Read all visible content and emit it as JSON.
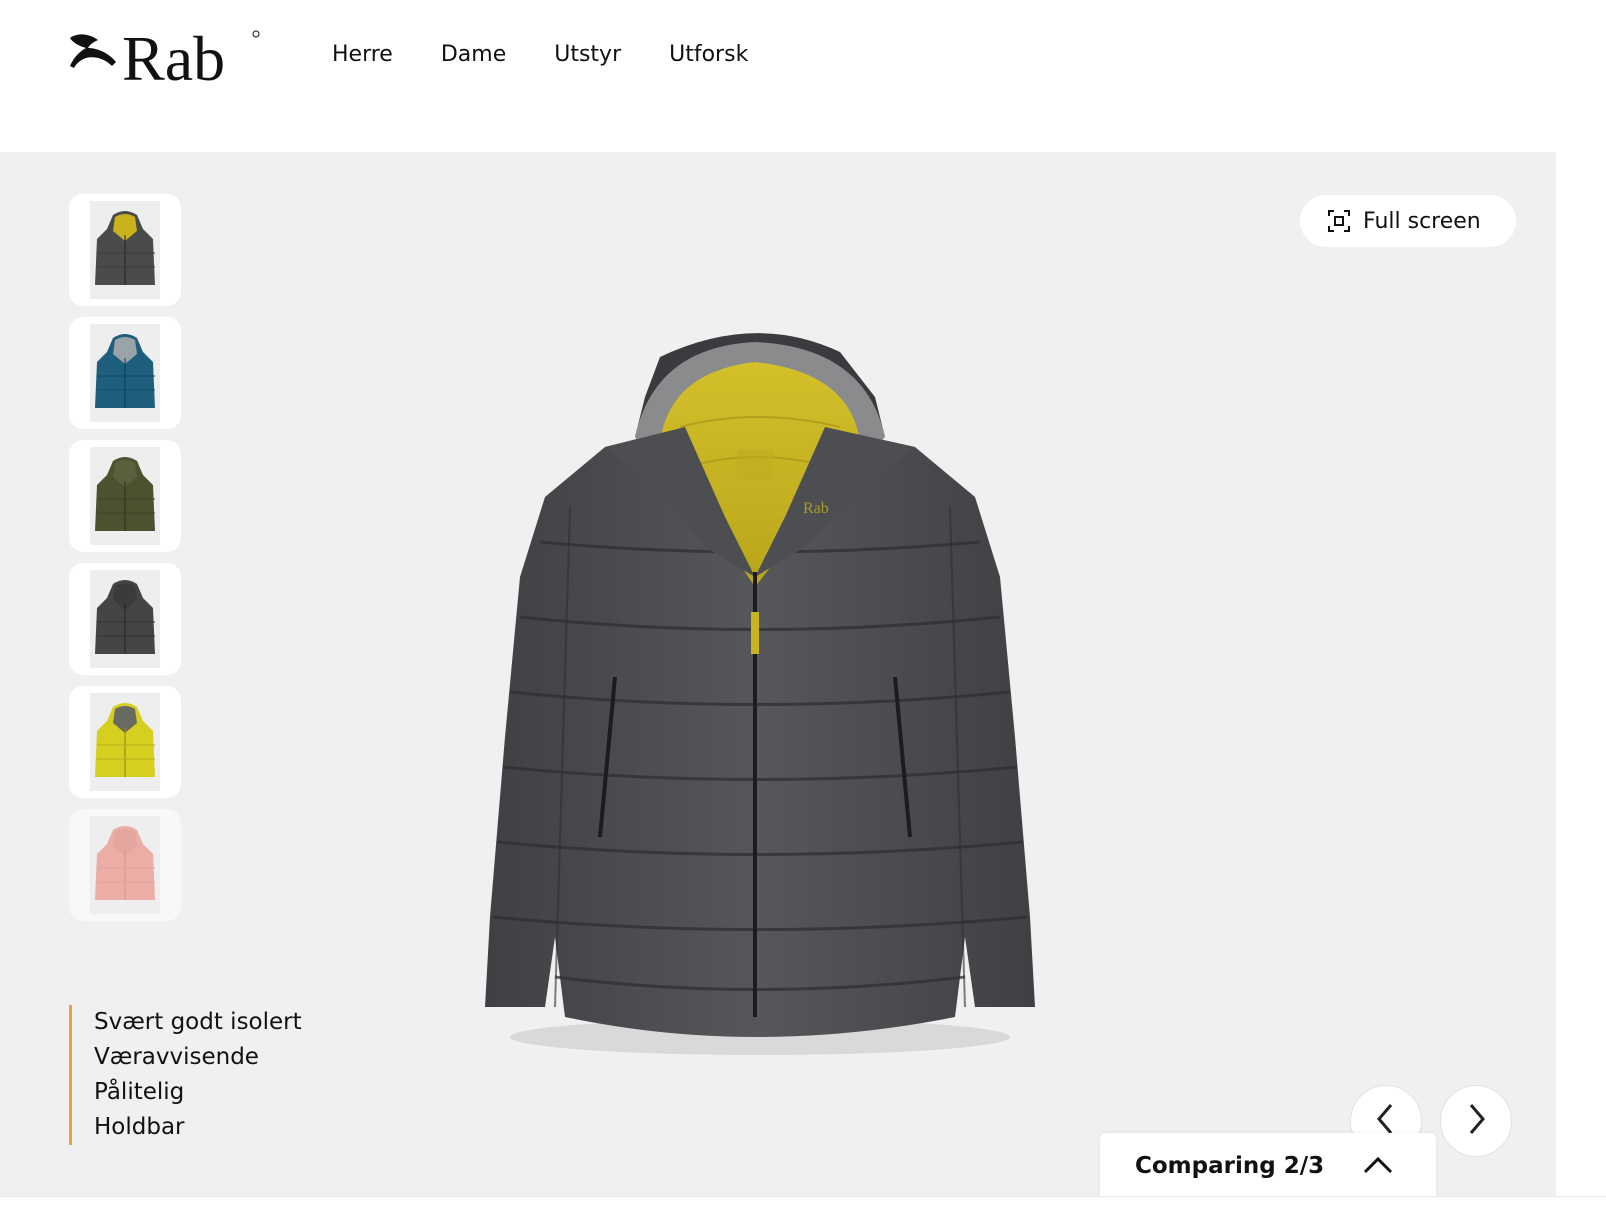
{
  "brand": {
    "logo_text": "Rab"
  },
  "nav": {
    "items": [
      "Herre",
      "Dame",
      "Utstyr",
      "Utforsk"
    ]
  },
  "gallery": {
    "fullscreen_label": "Full screen",
    "thumbnails": [
      {
        "body": "#4a4b4d",
        "accent": "#c9b21c"
      },
      {
        "body": "#1d5f7d",
        "accent": "#9aa3a8"
      },
      {
        "body": "#4b5230",
        "accent": "#5b5f3d"
      },
      {
        "body": "#444547",
        "accent": "#3a3b3d"
      },
      {
        "body": "#d6cf1f",
        "accent": "#6a6b60"
      },
      {
        "body": "#e8786a",
        "accent": "#d86a5c"
      }
    ],
    "features": [
      "Svært godt isolert",
      "Væravvisende",
      "Pålitelig",
      "Holdbar"
    ],
    "prev_icon": "chevron-left-icon",
    "next_icon": "chevron-right-icon"
  },
  "compare": {
    "label": "Comparing 2/3",
    "icon": "chevron-up-icon"
  },
  "colors": {
    "accent_bar": "#e0a73a",
    "gallery_bg": "#f0f0f1",
    "jacket_body": "#4a4b4e",
    "jacket_lining": "#c8b421"
  }
}
